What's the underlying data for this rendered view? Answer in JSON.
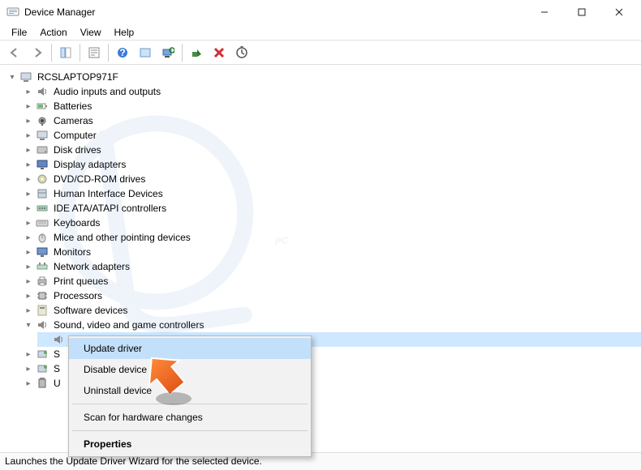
{
  "window": {
    "title": "Device Manager"
  },
  "menubar": {
    "file": "File",
    "action": "Action",
    "view": "View",
    "help": "Help"
  },
  "tree": {
    "root": "RCSLAPTOP971F",
    "categories": [
      "Audio inputs and outputs",
      "Batteries",
      "Cameras",
      "Computer",
      "Disk drives",
      "Display adapters",
      "DVD/CD-ROM drives",
      "Human Interface Devices",
      "IDE ATA/ATAPI controllers",
      "Keyboards",
      "Mice and other pointing devices",
      "Monitors",
      "Network adapters",
      "Print queues",
      "Processors",
      "Software devices",
      "Sound, video and game controllers"
    ],
    "truncated": [
      "S",
      "S",
      "U"
    ]
  },
  "context_menu": {
    "update": "Update driver",
    "disable": "Disable device",
    "uninstall": "Uninstall device",
    "scan": "Scan for hardware changes",
    "properties": "Properties"
  },
  "statusbar": {
    "text": "Launches the Update Driver Wizard for the selected device."
  }
}
